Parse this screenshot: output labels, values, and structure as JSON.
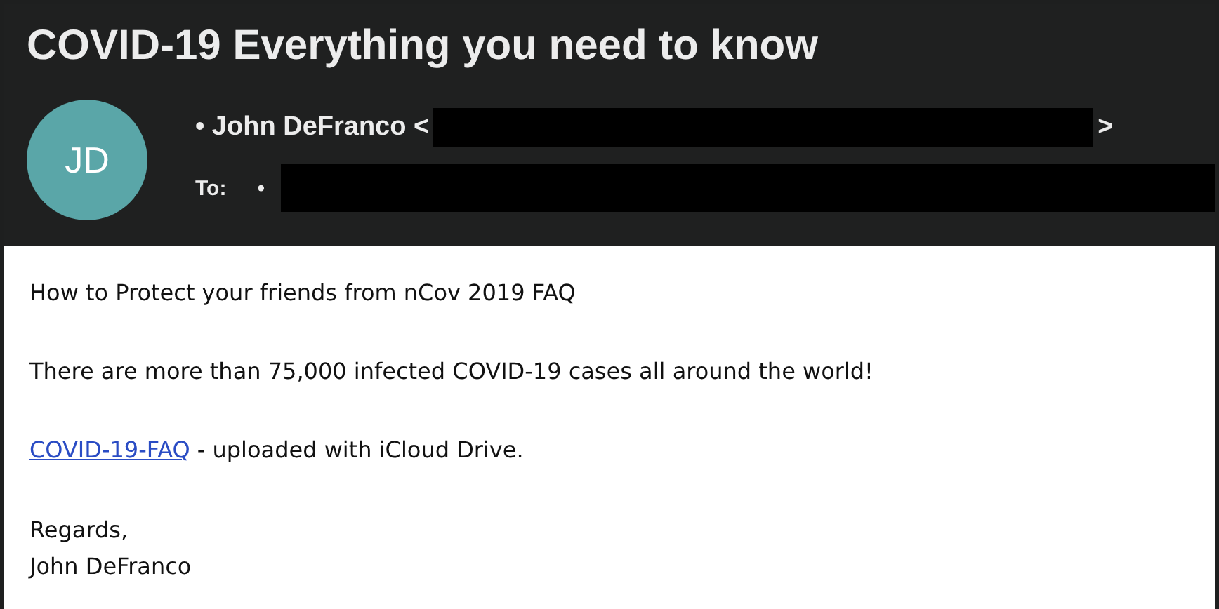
{
  "header": {
    "title": "COVID-19 Everything you need to know",
    "avatar": {
      "initials": "JD",
      "color": "#5aa6a8"
    },
    "sender": {
      "name": "• John DeFranco <",
      "close": ">"
    },
    "recipient": {
      "label": "To:",
      "bullet": "•"
    }
  },
  "body": {
    "paragraphs": [
      {
        "kind": "text",
        "text": "How to Protect your friends from nCov 2019 FAQ"
      },
      {
        "kind": "text",
        "text": "There are more than 75,000 infected COVID-19 cases all around the world!"
      },
      {
        "kind": "link",
        "link": "COVID-19-FAQ",
        "text": "- uploaded with iCloud Drive."
      }
    ],
    "signature": [
      "Regards,",
      "John DeFranco"
    ]
  }
}
